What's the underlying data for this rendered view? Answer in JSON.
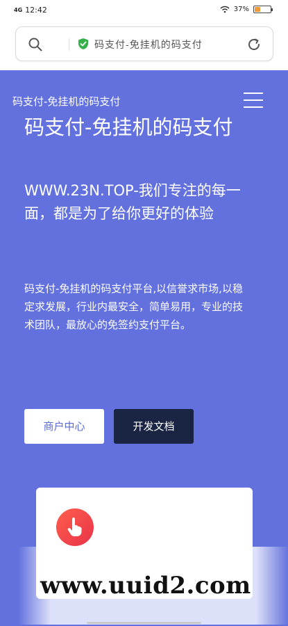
{
  "status_bar": {
    "network": "4G",
    "time": "12:42",
    "battery_level": 0.37,
    "battery_text": "37%",
    "icons": [
      "signal-icon",
      "wifi-icon",
      "battery-icon"
    ]
  },
  "browser": {
    "address_text": "码支付-免挂机的码支付",
    "icons": [
      "search-icon",
      "secure-shield-icon",
      "reload-icon"
    ]
  },
  "header": {
    "brand": "码支付-免挂机的码支付",
    "menu_icon": "hamburger-menu-icon"
  },
  "hero": {
    "title": "码支付-免挂机的码支付",
    "subtitle": "WWW.23N.TOP-我们专注的每一面，都是为了给你更好的体验",
    "description": "码支付-免挂机的码支付平台,以信誉求市场,以稳定求发展，行业内最安全，简单易用，专业的技术团队，最放心的免签约支付平台。",
    "background_color": "#6271dd"
  },
  "buttons": {
    "merchant_center": "商户中心",
    "developer_docs": "开发文档"
  },
  "feature": {
    "icon": "hand-pointer-icon"
  },
  "watermark": {
    "text": "www.uuid2.com"
  }
}
